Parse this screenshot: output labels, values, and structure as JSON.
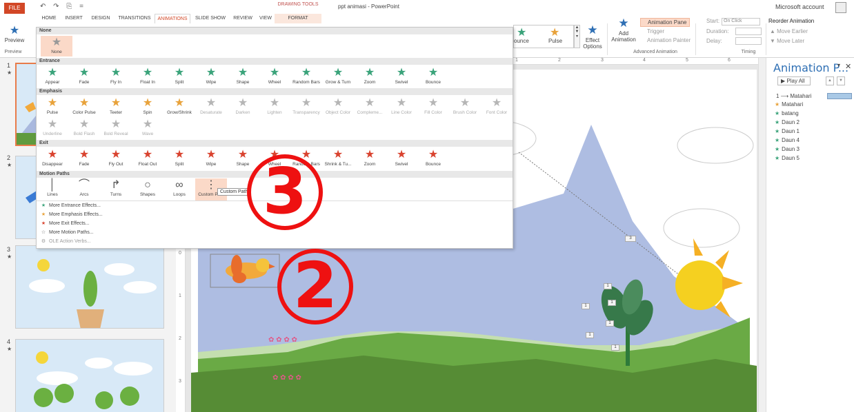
{
  "title_bar": {
    "file_tab": "FILE",
    "doc_title": "ppt animasi - PowerPoint",
    "context_title": "DRAWING TOOLS",
    "account": "Microsoft account",
    "qat": [
      "↶",
      "↷",
      "⎘",
      "="
    ]
  },
  "tabs": [
    "HOME",
    "INSERT",
    "DESIGN",
    "TRANSITIONS",
    "ANIMATIONS",
    "SLIDE SHOW",
    "REVIEW",
    "VIEW",
    "FORMAT"
  ],
  "active_tab": "ANIMATIONS",
  "ribbon": {
    "preview_label": "Preview",
    "preview_group": "Preview",
    "gallery_tail": [
      "ounce",
      "Pulse"
    ],
    "effect_options": "Effect Options",
    "add_animation": "Add Animation",
    "animation_pane": "Animation Pane",
    "trigger": "Trigger",
    "animation_painter": "Animation Painter",
    "advanced_group": "Advanced Animation",
    "start_label": "Start:",
    "start_value": "On Click",
    "duration_label": "Duration:",
    "delay_label": "Delay:",
    "timing_group": "Timing",
    "reorder_title": "Reorder Animation",
    "move_earlier": "Move Earlier",
    "move_later": "Move Later"
  },
  "gallery": {
    "none_header": "None",
    "none_item": "None",
    "entrance_header": "Entrance",
    "entrance": [
      "Appear",
      "Fade",
      "Fly In",
      "Float In",
      "Split",
      "Wipe",
      "Shape",
      "Wheel",
      "Random Bars",
      "Grow & Turn",
      "Zoom",
      "Swivel",
      "Bounce"
    ],
    "emphasis_header": "Emphasis",
    "emphasis_row1": [
      "Pulse",
      "Color Pulse",
      "Teeter",
      "Spin",
      "Grow/Shrink",
      "Desaturate",
      "Darken",
      "Lighten",
      "Transparency",
      "Object Color",
      "Compleme...",
      "Line Color",
      "Fill Color",
      "Brush Color",
      "Font Color"
    ],
    "emphasis_row2": [
      "Underline",
      "Bold Flash",
      "Bold Reveal",
      "Wave"
    ],
    "exit_header": "Exit",
    "exit": [
      "Disappear",
      "Fade",
      "Fly Out",
      "Float Out",
      "Split",
      "Wipe",
      "Shape",
      "Wheel",
      "Random Bars",
      "Shrink & Tu...",
      "Zoom",
      "Swivel",
      "Bounce"
    ],
    "motion_header": "Motion Paths",
    "motion": [
      "Lines",
      "Arcs",
      "Turns",
      "Shapes",
      "Loops",
      "Custom Path"
    ],
    "tooltip": "Custom Path",
    "more": [
      "More Entrance Effects...",
      "More Emphasis Effects...",
      "More Exit Effects...",
      "More Motion Paths...",
      "OLE Action Verbs..."
    ]
  },
  "slides": [
    {
      "num": "1",
      "star": "★"
    },
    {
      "num": "2",
      "star": "★"
    },
    {
      "num": "3",
      "star": "★"
    },
    {
      "num": "4",
      "star": "★"
    }
  ],
  "ruler": [
    "1",
    "2",
    "3",
    "4",
    "5",
    "6"
  ],
  "vruler": [
    "0",
    "1",
    "2",
    "3"
  ],
  "anim_pane": {
    "title": "Animation P...",
    "play_all": "Play All",
    "items": [
      {
        "label": "1 ⟶ Matahari",
        "color": "#2e6fb4"
      },
      {
        "label": "Matahari",
        "color": "#e8a23a"
      },
      {
        "label": "batang",
        "color": "#3aa37a"
      },
      {
        "label": "Daun 2",
        "color": "#3aa37a"
      },
      {
        "label": "Daun 1",
        "color": "#3aa37a"
      },
      {
        "label": "Daun 4",
        "color": "#3aa37a"
      },
      {
        "label": "Daun 3",
        "color": "#3aa37a"
      },
      {
        "label": "Daun 5",
        "color": "#3aa37a"
      }
    ]
  },
  "callouts": [
    "3",
    "2"
  ],
  "slide_tags": [
    "1",
    "1",
    "1",
    "1",
    "1",
    "1",
    "3"
  ],
  "colors": {
    "accent": "#d24726",
    "entrance": "#3aa37a",
    "emphasis": "#e8a23a",
    "exit": "#d9432f",
    "blue": "#2e6fb4",
    "callout": "#ee1111"
  }
}
